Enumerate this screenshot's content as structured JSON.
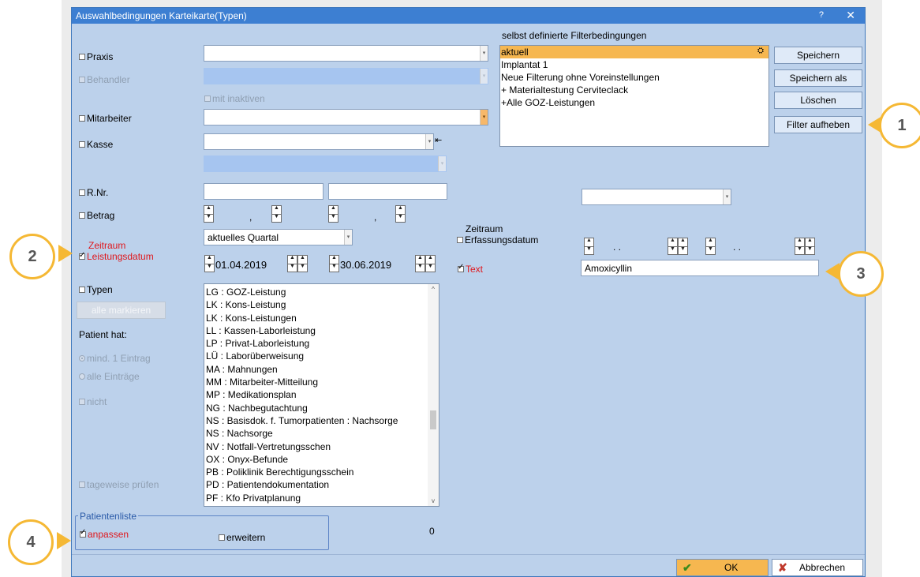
{
  "window": {
    "title": "Auswahlbedingungen Karteikarte(Typen)",
    "help": "?",
    "close": "✕"
  },
  "filters": {
    "header": "selbst definierte Filterbedingungen",
    "items": [
      "aktuell",
      "Implantat 1",
      "Neue Filterung ohne Voreinstellungen",
      "+ Materialtestung Cerviteclack",
      "+Alle GOZ-Leistungen"
    ],
    "selected_index": 0,
    "buttons": {
      "save": "Speichern",
      "save_as": "Speichern als",
      "delete": "Löschen",
      "clear": "Filter aufheben"
    }
  },
  "form": {
    "praxis": "Praxis",
    "behandler": "Behandler",
    "mit_inaktiven": "mit inaktiven",
    "mitarbeiter": "Mitarbeiter",
    "kasse": "Kasse",
    "rnr": "R.Nr.",
    "betrag": "Betrag",
    "betrag_sep": ",",
    "zeitraum_leistung_1": "Zeitraum",
    "zeitraum_leistung_2": "Leistungsdatum",
    "quartal_value": "aktuelles Quartal",
    "date_from": "01.04.2019",
    "date_to": "30.06.2019",
    "zeitraum_erfassung_1": "Zeitraum",
    "zeitraum_erfassung_2": "Erfassungsdatum",
    "erfassung_date_placeholder": ". .",
    "text_label": "Text",
    "text_value": "Amoxicyllin",
    "typen": "Typen",
    "alle_markieren": "alle markieren",
    "patient_hat": "Patient hat:",
    "mind_eintrag": "mind. 1 Eintrag",
    "alle_eintraege": "alle Einträge",
    "nicht": "nicht",
    "tageweise": "tageweise prüfen"
  },
  "types_list": [
    "LG : GOZ-Leistung",
    "LK : Kons-Leistung",
    "LK : Kons-Leistungen",
    "LL : Kassen-Laborleistung",
    "LP : Privat-Laborleistung",
    "LÜ : Laborüberweisung",
    "MA : Mahnungen",
    "MM : Mitarbeiter-Mitteilung",
    "MP : Medikationsplan",
    "NG : Nachbegutachtung",
    "NS : Basisdok. f. Tumorpatienten : Nachsorge",
    "NS : Nachsorge",
    "NV : Notfall-Vertretungsschen",
    "OX : Onyx-Befunde",
    "PB : Poliklinik Berechtigungsschein",
    "PD : Patientendokumentation",
    "PF : Kfo Privatplanung"
  ],
  "patientenliste": {
    "legend": "Patientenliste",
    "anpassen": "anpassen",
    "erweitern": "erweitern",
    "count": "0"
  },
  "footer": {
    "ok": "OK",
    "cancel": "Abbrechen"
  },
  "callouts": [
    "1",
    "2",
    "3",
    "4"
  ],
  "colors": {
    "dialog_bg": "#bcd1eb",
    "titlebar": "#3d7fd2",
    "highlight": "#f6b750",
    "callout_border": "#f5b834",
    "red": "#e0171c"
  }
}
